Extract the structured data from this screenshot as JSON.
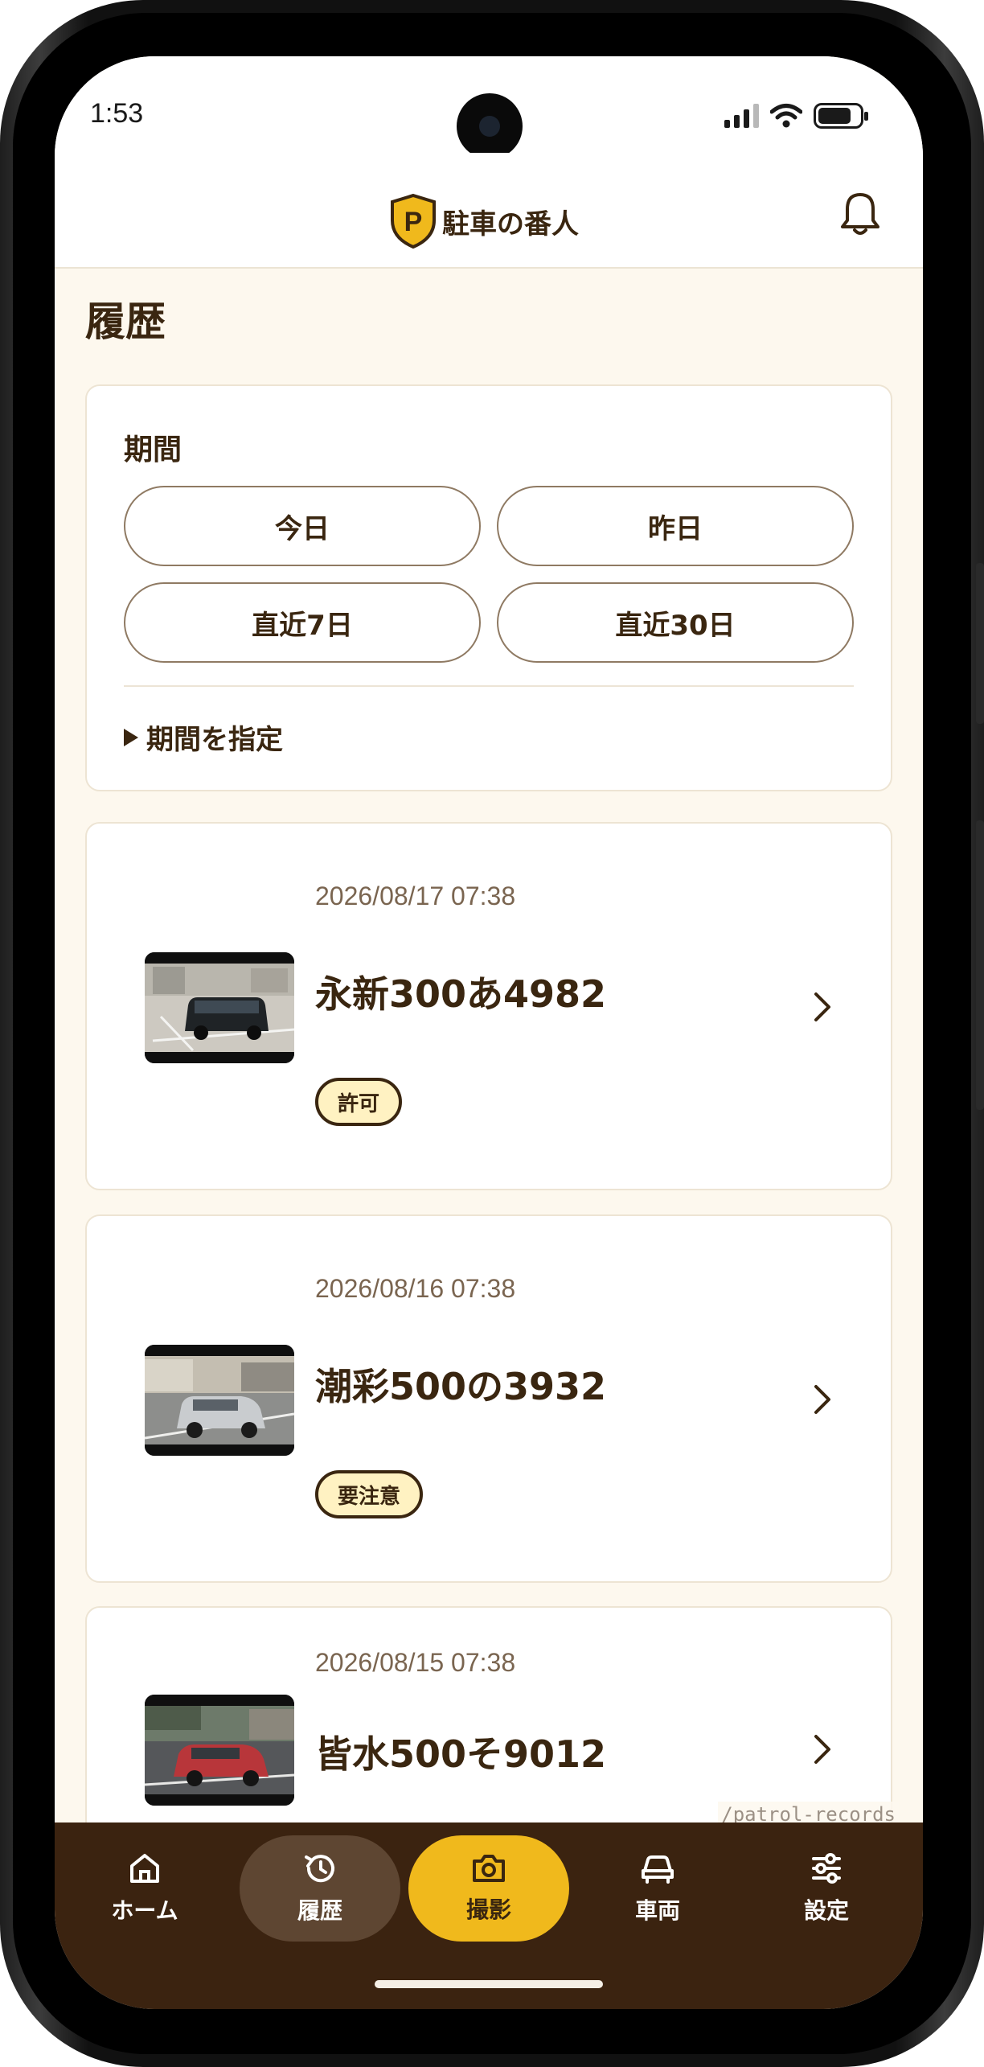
{
  "status_bar": {
    "time": "1:53"
  },
  "app": {
    "name": "駐車の番人",
    "logo_letter": "P"
  },
  "page": {
    "title": "履歴"
  },
  "filter": {
    "label": "期間",
    "presets": [
      "今日",
      "昨日",
      "直近7日",
      "直近30日"
    ],
    "custom_range_label": "期間を指定"
  },
  "records": [
    {
      "date": "2026/08/17 07:38",
      "plate": "永新300あ4982",
      "status": "許可"
    },
    {
      "date": "2026/08/16 07:38",
      "plate": "潮彩500の3932",
      "status": "要注意"
    },
    {
      "date": "2026/08/15 07:38",
      "plate": "皆水500そ9012"
    }
  ],
  "route_label": "/patrol-records",
  "nav": {
    "items": [
      {
        "label": "ホーム",
        "icon": "home-icon"
      },
      {
        "label": "履歴",
        "icon": "history-icon",
        "active": true
      },
      {
        "label": "撮影",
        "icon": "camera-icon"
      },
      {
        "label": "車両",
        "icon": "car-icon"
      },
      {
        "label": "設定",
        "icon": "sliders-icon"
      }
    ]
  },
  "colors": {
    "brand_brown": "#3b2310",
    "accent_yellow": "#f0b91c",
    "badge_fill": "#fff2c2",
    "page_background": "#fdf8ee"
  }
}
